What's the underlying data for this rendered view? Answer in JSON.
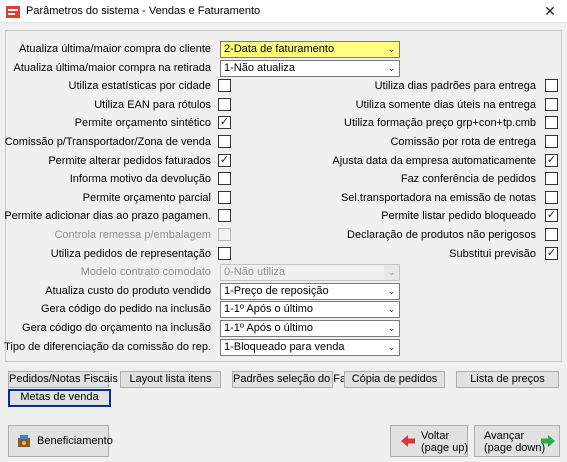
{
  "window": {
    "title": "Parâmetros do sistema - Vendas e Faturamento",
    "close_glyph": "✕"
  },
  "left_rows": [
    {
      "label": "Atualiza última/maior compra do cliente",
      "kind": "combo",
      "value": "2-Data de faturamento",
      "highlight": true
    },
    {
      "label": "Atualiza última/maior compra na retirada",
      "kind": "combo",
      "value": "1-Não atualiza"
    },
    {
      "label": "Utiliza estatísticas por cidade",
      "kind": "check",
      "checked": false
    },
    {
      "label": "Utiliza EAN para rótulos",
      "kind": "check",
      "checked": false
    },
    {
      "label": "Permite orçamento sintético",
      "kind": "check",
      "checked": true
    },
    {
      "label": "Comissão p/Transportador/Zona de venda",
      "kind": "check",
      "checked": false
    },
    {
      "label": "Permite alterar pedidos faturados",
      "kind": "check",
      "checked": true
    },
    {
      "label": "Informa motivo da devolução",
      "kind": "check",
      "checked": false
    },
    {
      "label": "Permite orçamento parcial",
      "kind": "check",
      "checked": false
    },
    {
      "label": "Permite adicionar dias ao prazo pagamen.",
      "kind": "check",
      "checked": false
    },
    {
      "label": "Controla remessa p/embalagem",
      "kind": "check",
      "checked": false,
      "disabled": true
    },
    {
      "label": "Utiliza pedidos de representação",
      "kind": "check",
      "checked": false
    },
    {
      "label": "Modelo contrato comodato",
      "kind": "combo",
      "value": "0-Não utiliza",
      "disabled": true
    },
    {
      "label": "Atualiza custo do produto vendido",
      "kind": "combo",
      "value": "1-Preço de reposição"
    },
    {
      "label": "Gera código do pedido na inclusão",
      "kind": "combo",
      "value": "1-1º Após o último"
    },
    {
      "label": "Gera código do orçamento na inclusão",
      "kind": "combo",
      "value": "1-1º Após o último"
    },
    {
      "label": "Tipo de diferenciação da comissão do rep.",
      "kind": "combo",
      "value": "1-Bloqueado para venda"
    }
  ],
  "right_rows": [
    {
      "label": "Utiliza dias padrões para entrega",
      "checked": false
    },
    {
      "label": "Utiliza somente dias úteis na entrega",
      "checked": false
    },
    {
      "label": "Utiliza formação preço grp+con+tp.cmb",
      "checked": false
    },
    {
      "label": "Comissão por rota de entrega",
      "checked": false
    },
    {
      "label": "Ajusta data da empresa automaticamente",
      "checked": true
    },
    {
      "label": "Faz conferência de pedidos",
      "checked": false
    },
    {
      "label": "Sel.transportadora na emissão de notas",
      "checked": false
    },
    {
      "label": "Permite listar pedido bloqueado",
      "checked": true
    },
    {
      "label": "Declaração de produtos não perigosos",
      "checked": false
    },
    {
      "label": "Substitui previsão",
      "checked": true
    }
  ],
  "buttons": {
    "pedidos_notas": "Pedidos/Notas Fiscais",
    "layout_lista": "Layout lista itens",
    "padroes_selecao": "Padrões seleção do Fat.",
    "copia_pedidos": "Cópia de pedidos",
    "lista_precos": "Lista de preços",
    "metas_venda": "Metas de venda"
  },
  "footer": {
    "beneficiamento": "Beneficiamento",
    "voltar_line1": "Voltar",
    "voltar_line2": "(page up)",
    "avancar_line1": "Avançar",
    "avancar_line2": "(page down)"
  },
  "icons": {
    "check_glyph": "✓",
    "combo_arrow": "⌄",
    "back_arrow_color": "#d9383a",
    "forward_arrow_color": "#2fa84f"
  }
}
